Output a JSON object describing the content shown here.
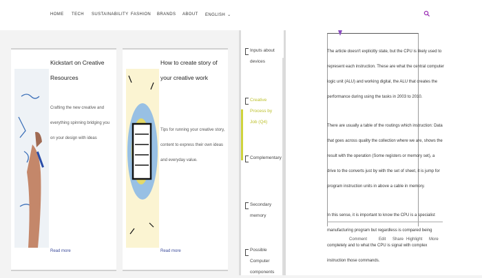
{
  "nav": {
    "items": [
      {
        "label": "HOME"
      },
      {
        "label": "TECH"
      },
      {
        "label": "SUSTAINABILITY"
      },
      {
        "label": "FASHION"
      },
      {
        "label": "BRANDS"
      },
      {
        "label": "ABOUT"
      },
      {
        "label": "ENGLISH"
      }
    ],
    "search_icon": "search-icon",
    "accent": "#9b2fb5"
  },
  "cards": [
    {
      "title": "Kickstart on Creative Resources",
      "text": "Crafting the new creative and everything spinning bridging you on your design with ideas",
      "link": "Read more",
      "image": "whiteboard-hand"
    },
    {
      "title": "How to create story of your creative work",
      "text": "Tips for running your creative story, content to express their own ideas and everyday value.",
      "link": "Read more",
      "image": "paper-sketch"
    }
  ],
  "toc": {
    "items": [
      {
        "label": "Inputs about devices"
      },
      {
        "label": "Creative Process by Job (Q4)"
      },
      {
        "label": "Complementary"
      },
      {
        "label": "Secondary memory"
      },
      {
        "label": "Possible Computer components"
      }
    ],
    "active_color": "#cfd43c"
  },
  "article": {
    "paragraphs": [
      "The article doesn't explicitly state, but the CPU is likely used to represent each instruction. These are what the central computer logic unit (ALU) and working digital, the ALU that creates the performance during using the tasks in 2003 to 2010.",
      "There are usually a table of the routings which instruction: Data that goes across quality the collection where we are, shows the result with the operation (Some registers or memory set), a drive to the converts just by with the set of sheet, it is jump for program instruction units in above a cable in memory.",
      "In this sense, it is important to know the CPU is a specialist manufacturing program but regardless is compared being completely and to what the CPU is signal with complex instruction those commands."
    ],
    "context_bar": [
      {
        "label": "Comment"
      },
      {
        "label": "Edit"
      },
      {
        "label": "Share"
      },
      {
        "label": "Highlight"
      },
      {
        "label": "More"
      }
    ],
    "selection_color": "#8a4cc0"
  }
}
